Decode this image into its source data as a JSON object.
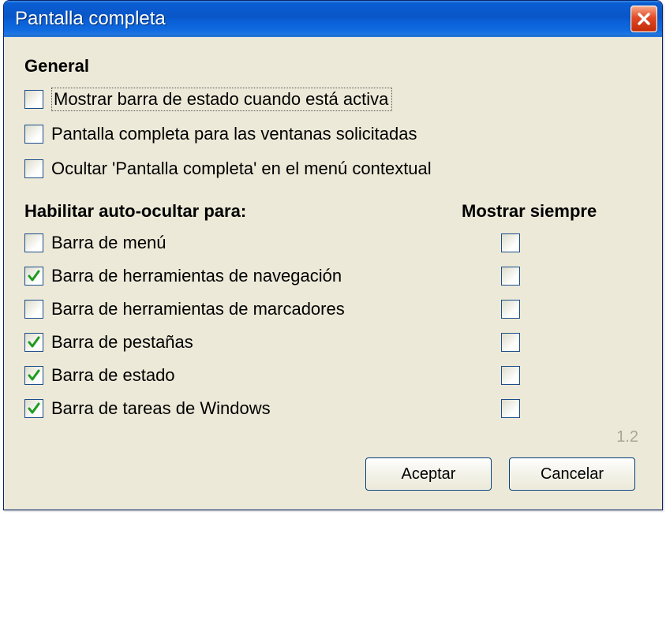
{
  "dialog": {
    "title": "Pantalla completa"
  },
  "general": {
    "heading": "General",
    "items": [
      {
        "label": "Mostrar barra de estado cuando está activa",
        "checked": false,
        "focused": true
      },
      {
        "label": "Pantalla completa para las ventanas solicitadas",
        "checked": false,
        "focused": false
      },
      {
        "label": "Ocultar 'Pantalla completa' en el menú contextual",
        "checked": false,
        "focused": false
      }
    ]
  },
  "autohide": {
    "heading_left": "Habilitar auto-ocultar para:",
    "heading_right": "Mostrar siempre",
    "rows": [
      {
        "label": "Barra de menú",
        "hide_checked": false,
        "always_checked": false
      },
      {
        "label": "Barra de herramientas de navegación",
        "hide_checked": true,
        "always_checked": false
      },
      {
        "label": "Barra de herramientas de marcadores",
        "hide_checked": false,
        "always_checked": false
      },
      {
        "label": "Barra de pestañas",
        "hide_checked": true,
        "always_checked": false
      },
      {
        "label": "Barra de estado",
        "hide_checked": true,
        "always_checked": false
      },
      {
        "label": "Barra de tareas de Windows",
        "hide_checked": true,
        "always_checked": false
      }
    ]
  },
  "version": "1.2",
  "buttons": {
    "accept": "Aceptar",
    "cancel": "Cancelar"
  }
}
